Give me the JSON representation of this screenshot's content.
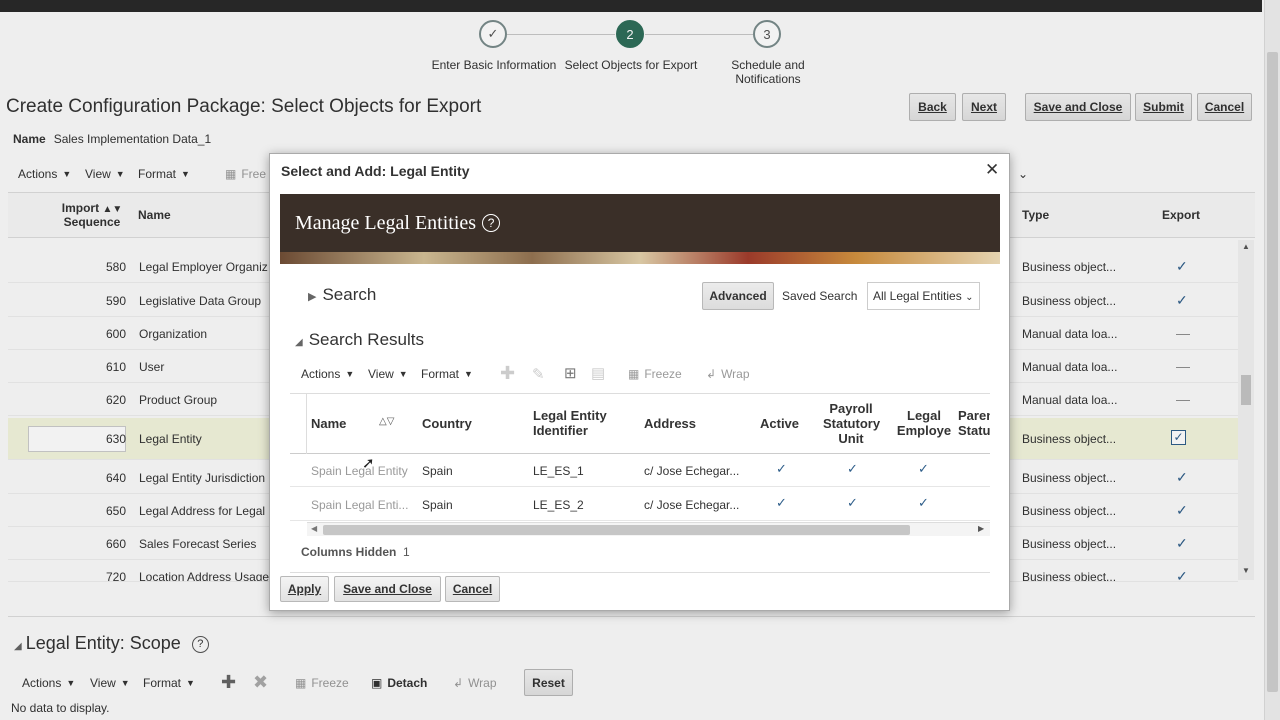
{
  "train": {
    "steps": [
      {
        "number": "✓",
        "label": "Enter Basic Information"
      },
      {
        "number": "2",
        "label": "Select Objects for Export"
      },
      {
        "number": "3",
        "label": "Schedule and Notifications"
      }
    ]
  },
  "page": {
    "title": "Create Configuration Package: Select Objects for Export",
    "name_label": "Name",
    "name_value": "Sales Implementation Data_1"
  },
  "buttons": {
    "back": "Back",
    "next": "Next",
    "save_close": "Save and Close",
    "submit": "Submit",
    "cancel": "Cancel"
  },
  "main_toolbar": {
    "actions": "Actions",
    "view": "View",
    "format": "Format",
    "freeze": "Free"
  },
  "main_table": {
    "headers": {
      "import": "Import",
      "sequence": "Sequence",
      "name": "Name",
      "type": "Type",
      "export": "Export"
    },
    "rows": [
      {
        "seq": "580",
        "name": "Legal Employer Organiz",
        "type": "Business object...",
        "export": "✓"
      },
      {
        "seq": "590",
        "name": "Legislative Data Group",
        "type": "Business object...",
        "export": "✓"
      },
      {
        "seq": "600",
        "name": "Organization",
        "type": "Manual data loa...",
        "export": "—"
      },
      {
        "seq": "610",
        "name": "User",
        "type": "Manual data loa...",
        "export": "—"
      },
      {
        "seq": "620",
        "name": "Product Group",
        "type": "Manual data loa...",
        "export": "—"
      },
      {
        "seq": "630",
        "name": "Legal Entity",
        "type": "Business object...",
        "export": "✓"
      },
      {
        "seq": "640",
        "name": "Legal Entity Jurisdiction",
        "type": "Business object...",
        "export": "✓"
      },
      {
        "seq": "650",
        "name": "Legal Address for Legal",
        "type": "Business object...",
        "export": "✓"
      },
      {
        "seq": "660",
        "name": "Sales Forecast Series",
        "type": "Business object...",
        "export": "✓"
      },
      {
        "seq": "720",
        "name": "Location Address Usage",
        "type": "Business object...",
        "export": "✓"
      }
    ]
  },
  "scope": {
    "title": "Legal Entity: Scope",
    "toolbar": {
      "actions": "Actions",
      "view": "View",
      "format": "Format",
      "freeze": "Freeze",
      "detach": "Detach",
      "wrap": "Wrap",
      "reset": "Reset"
    },
    "empty": "No data to display."
  },
  "dialog": {
    "title": "Select and Add: Legal Entity",
    "banner_title": "Manage Legal Entities",
    "search_label": "Search",
    "advanced": "Advanced",
    "saved_search_label": "Saved Search",
    "saved_search_value": "All Legal Entities",
    "results_label": "Search Results",
    "toolbar": {
      "actions": "Actions",
      "view": "View",
      "format": "Format",
      "freeze": "Freeze",
      "wrap": "Wrap"
    },
    "headers": {
      "name": "Name",
      "country": "Country",
      "identifier": "Legal Entity Identifier",
      "address": "Address",
      "active": "Active",
      "payroll": "Payroll Statutory Unit",
      "employer": "Legal Employe",
      "parent": "Paren Statu"
    },
    "rows": [
      {
        "name": "Spain Legal Entity",
        "country": "Spain",
        "identifier": "LE_ES_1",
        "address": "c/ Jose Echegar...",
        "active": "✓",
        "payroll": "✓",
        "employer": "✓"
      },
      {
        "name": "Spain Legal Enti...",
        "country": "Spain",
        "identifier": "LE_ES_2",
        "address": "c/ Jose Echegar...",
        "active": "✓",
        "payroll": "✓",
        "employer": "✓"
      }
    ],
    "columns_hidden_label": "Columns Hidden",
    "columns_hidden_count": "1",
    "apply": "Apply",
    "save_close": "Save and Close",
    "cancel": "Cancel"
  }
}
